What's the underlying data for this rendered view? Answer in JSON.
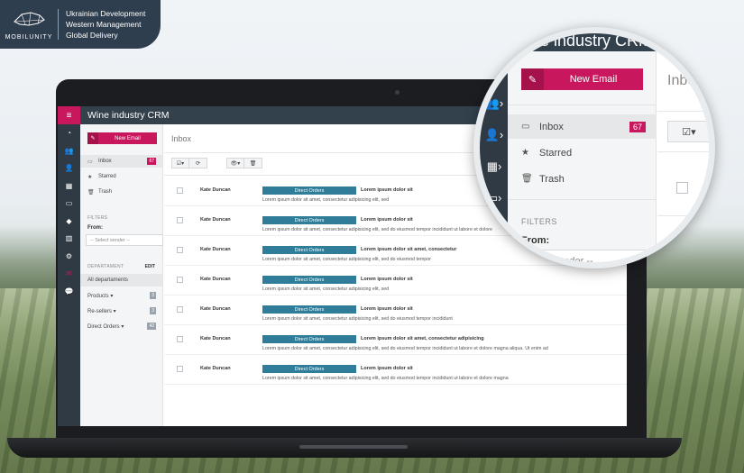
{
  "brand": {
    "name": "MOBILUNITY",
    "lines": [
      "Ukrainian Development",
      "Western Management",
      "Global Delivery"
    ]
  },
  "app": {
    "title": "Wine industry CRM",
    "new_email_label": "New Email",
    "inbox_title": "Inbox"
  },
  "folders": [
    {
      "label": "Inbox",
      "count": "67"
    },
    {
      "label": "Starred"
    },
    {
      "label": "Trash"
    }
  ],
  "filters": {
    "label": "FILTERS",
    "from_label": "From:",
    "sender_placeholder": "-- Select sender --"
  },
  "departments": {
    "label": "DEPARTAMENT",
    "edit_label": "EDIT",
    "items": [
      {
        "label": "All departaments"
      },
      {
        "label": "Products ▾",
        "count": "3"
      },
      {
        "label": "Re-sellers ▾",
        "count": "3"
      },
      {
        "label": "Direct Orders ▾",
        "count": "42"
      }
    ]
  },
  "toolbar": {
    "check_icon": "☑▾",
    "refresh_icon": "⟳",
    "view_icon": "👁▾",
    "trash_icon": "🗑"
  },
  "messages": [
    {
      "from": "Kate Duncan",
      "tag": "Direct Orders",
      "subject": "Lorem ipsum dolor sit",
      "preview": "Lorem ipsum dolor sit amet, consectetur adipisicing elit, sed"
    },
    {
      "from": "Kate Duncan",
      "tag": "Direct Orders",
      "subject": "Lorem ipsum dolor sit",
      "preview": "Lorem ipsum dolor sit amet, consectetur adipisicing elit, sed do eiusmod tempor incididunt ut labore et dolore"
    },
    {
      "from": "Kate Duncan",
      "tag": "Direct Orders",
      "subject": "Lorem ipsum dolor sit amet, consectetur",
      "preview": "Lorem ipsum dolor sit amet, consectetur adipisicing elit, sed do eiusmod tempor"
    },
    {
      "from": "Kate Duncan",
      "tag": "Direct Orders",
      "subject": "Lorem ipsum dolor sit",
      "preview": "Lorem ipsum dolor sit amet, consectetur adipisicing elit, sed"
    },
    {
      "from": "Kate Duncan",
      "tag": "Direct Orders",
      "subject": "Lorem ipsum dolor sit",
      "preview": "Lorem ipsum dolor sit amet, consectetur adipisicing elit, sed do eiusmod tempor incididunt"
    },
    {
      "from": "Kate Duncan",
      "tag": "Direct Orders",
      "subject": "Lorem ipsum dolor sit amet, consectetur adipisicing",
      "preview": "Lorem ipsum dolor sit amet, consectetur adipisicing elit, sed do eiusmod tempor incididunt ut labore et dolore magna aliqua. Ut enim ad"
    },
    {
      "from": "Kate Duncan",
      "tag": "Direct Orders",
      "subject": "Lorem ipsum dolor sit",
      "preview": "Lorem ipsum dolor sit amet, consectetur adipisicing elit, sed do eiusmod tempor incididunt ut labore et dolore magna"
    }
  ],
  "magnifier": {
    "title": "ine industry CRM",
    "new_email_label": "New Email",
    "inbox_title": "Inbox",
    "folders": [
      {
        "label": "Inbox",
        "count": "67"
      },
      {
        "label": "Starred"
      },
      {
        "label": "Trash"
      }
    ],
    "filters_label": "FILTERS",
    "from_label": "From:",
    "sender_partial": "ct sender --"
  },
  "colors": {
    "accent": "#c8175c",
    "dark": "#2f3a44",
    "tag": "#2f7d99"
  }
}
